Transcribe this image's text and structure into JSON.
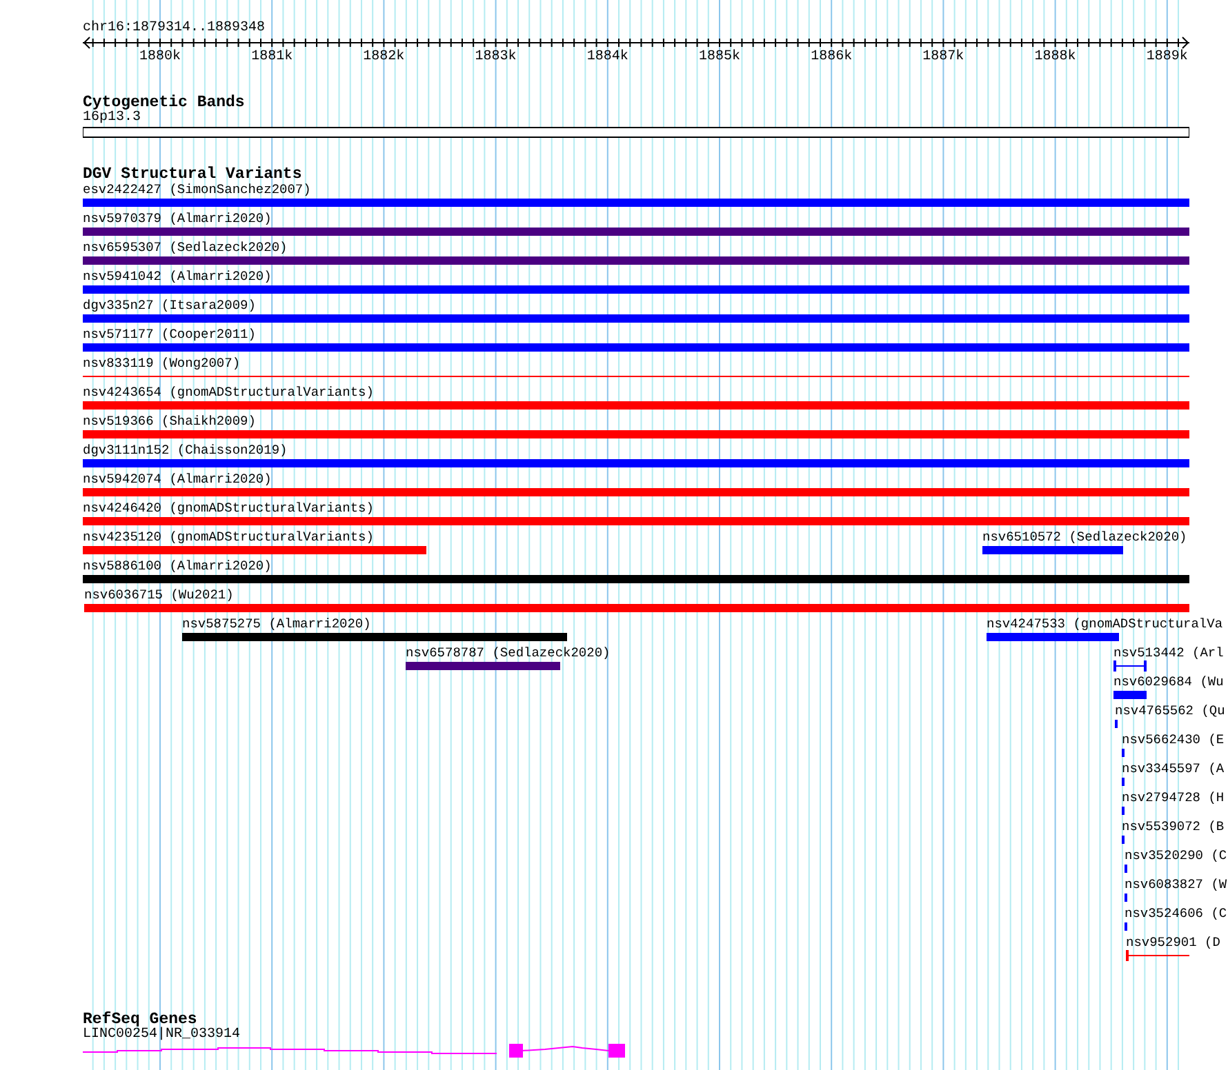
{
  "position": "chr16:1879314..1889348",
  "ruler": {
    "ticks": [
      "1880k",
      "1881k",
      "1882k",
      "1883k",
      "1884k",
      "1885k",
      "1886k",
      "1887k",
      "1888k",
      "1889k"
    ]
  },
  "tracks": [
    {
      "kind": "cytoband",
      "title": "Cytogenetic Bands",
      "items": [
        {
          "label": "16p13.3"
        }
      ]
    },
    {
      "kind": "variants",
      "title": "DGV Structural Variants",
      "rows": [
        {
          "features": [
            {
              "label": "esv2422427 (SimonSanchez2007)",
              "color": "#0000ff",
              "kind": "bar"
            }
          ]
        },
        {
          "features": [
            {
              "label": "nsv5970379 (Almarri2020)",
              "color": "#4b0082",
              "kind": "bar"
            }
          ]
        },
        {
          "features": [
            {
              "label": "nsv6595307 (Sedlazeck2020)",
              "color": "#4b0082",
              "kind": "bar"
            }
          ]
        },
        {
          "features": [
            {
              "label": "nsv5941042 (Almarri2020)",
              "color": "#0000ff",
              "kind": "bar"
            }
          ]
        },
        {
          "features": [
            {
              "label": "dgv335n27 (Itsara2009)",
              "color": "#0000ff",
              "kind": "bar"
            }
          ]
        },
        {
          "features": [
            {
              "label": "nsv571177 (Cooper2011)",
              "color": "#0000ff",
              "kind": "bar"
            }
          ]
        },
        {
          "features": [
            {
              "label": "nsv833119 (Wong2007)",
              "color": "#ff0000",
              "kind": "line"
            }
          ]
        },
        {
          "features": [
            {
              "label": "nsv4243654 (gnomADStructuralVariants)",
              "color": "#ff0000",
              "kind": "bar"
            }
          ]
        },
        {
          "features": [
            {
              "label": "nsv519366 (Shaikh2009)",
              "color": "#ff0000",
              "kind": "bar"
            }
          ]
        },
        {
          "features": [
            {
              "label": "dgv3111n152 (Chaisson2019)",
              "color": "#0000ff",
              "kind": "bar"
            }
          ]
        },
        {
          "features": [
            {
              "label": "nsv5942074 (Almarri2020)",
              "color": "#ff0000",
              "kind": "bar"
            }
          ]
        },
        {
          "features": [
            {
              "label": "nsv4246420 (gnomADStructuralVariants)",
              "color": "#ff0000",
              "kind": "bar"
            }
          ]
        },
        {
          "features": [
            {
              "label": "nsv4235120 (gnomADStructuralVariants)",
              "color": "#ff0000",
              "kind": "bar"
            },
            {
              "label": "nsv6510572 (Sedlazeck2020)",
              "color": "#0000ff",
              "kind": "bar"
            }
          ]
        },
        {
          "features": [
            {
              "label": "nsv5886100 (Almarri2020)",
              "color": "#000000",
              "kind": "bar"
            }
          ]
        },
        {
          "features": [
            {
              "label": "nsv6036715 (Wu2021)",
              "color": "#ff0000",
              "kind": "bar"
            }
          ]
        },
        {
          "features": [
            {
              "label": "nsv5875275 (Almarri2020)",
              "color": "#000000",
              "kind": "bar"
            },
            {
              "label": "nsv4247533 (gnomADStructuralVa",
              "color": "#0000ff",
              "kind": "bar"
            }
          ]
        },
        {
          "features": [
            {
              "label": "nsv6578787 (Sedlazeck2020)",
              "color": "#4b0082",
              "kind": "bar"
            },
            {
              "label": "nsv513442 (Arl",
              "color": "#0000ff",
              "kind": "line"
            }
          ]
        },
        {
          "features": [
            {
              "label": "nsv6029684 (Wu",
              "color": "#0000ff",
              "kind": "bar"
            }
          ]
        },
        {
          "features": [
            {
              "label": "nsv4765562 (Qu",
              "color": "#0000ff",
              "kind": "bar"
            }
          ]
        },
        {
          "features": [
            {
              "label": "nsv5662430 (E",
              "color": "#0000ff",
              "kind": "bar"
            }
          ]
        },
        {
          "features": [
            {
              "label": "nsv3345597 (A",
              "color": "#0000ff",
              "kind": "bar"
            }
          ]
        },
        {
          "features": [
            {
              "label": "nsv2794728 (H",
              "color": "#0000ff",
              "kind": "bar"
            }
          ]
        },
        {
          "features": [
            {
              "label": "nsv5539072 (B",
              "color": "#0000ff",
              "kind": "bar"
            }
          ]
        },
        {
          "features": [
            {
              "label": "nsv3520290 (C",
              "color": "#0000ff",
              "kind": "bar"
            }
          ]
        },
        {
          "features": [
            {
              "label": "nsv6083827 (W",
              "color": "#0000ff",
              "kind": "bar"
            }
          ]
        },
        {
          "features": [
            {
              "label": "nsv3524606 (C",
              "color": "#0000ff",
              "kind": "bar"
            }
          ]
        },
        {
          "features": [
            {
              "label": "nsv952901 (D",
              "color": "#ff0000",
              "kind": "line"
            }
          ]
        }
      ]
    },
    {
      "kind": "genes",
      "title": "RefSeq Genes",
      "items": [
        {
          "label": "LINC00254|NR_033914"
        }
      ]
    }
  ]
}
